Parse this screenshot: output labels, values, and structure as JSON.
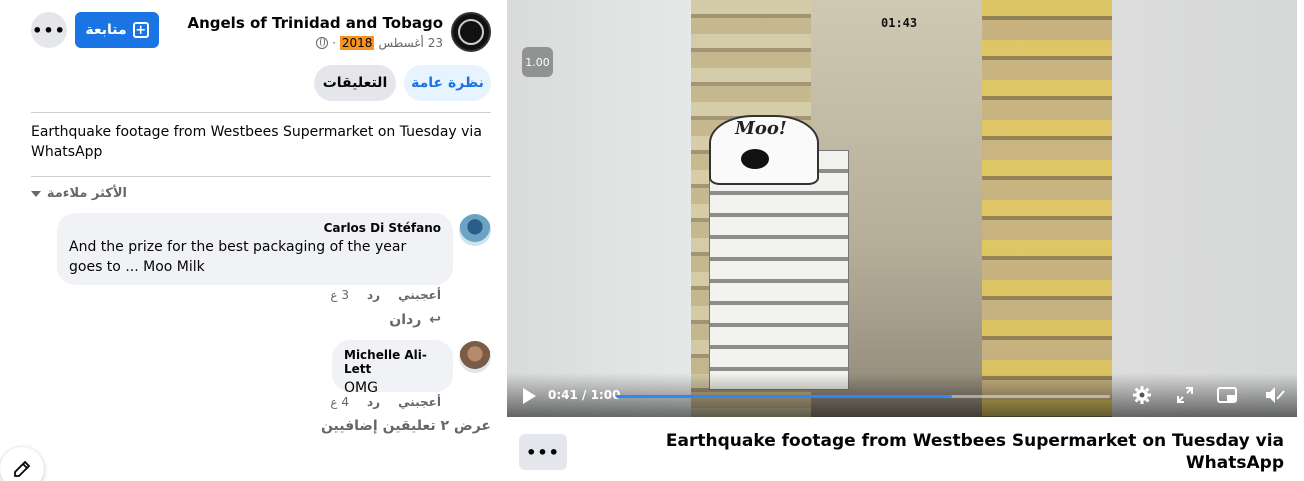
{
  "header": {
    "page_name": "Angels of Trinidad and Tobago",
    "date_prefix": "23 أغسطس",
    "date_year": "2018",
    "follow_label": "متابعة",
    "more_label": "•••"
  },
  "tabs": [
    {
      "label": "نظرة عامة",
      "active": true
    },
    {
      "label": "التعليقات",
      "active": false
    }
  ],
  "caption": "Earthquake footage from Westbees Supermarket on Tuesday via WhatsApp",
  "comments": {
    "sort_label": "الأكثر ملاءمة",
    "items": [
      {
        "author": "Carlos Di Stéfano",
        "text": "And the prize for the best packaging of the year goes to ... Moo Milk",
        "like_label": "أعجبني",
        "reply_label": "رد",
        "time": "3 ع",
        "replies_label": "ردان"
      },
      {
        "author": "Michelle Ali-Lett",
        "text": "OMG",
        "like_label": "أعجبني",
        "reply_label": "رد",
        "time": "4 ع"
      }
    ],
    "more_comments_label": "عرض ٢ تعليقين إضافيين"
  },
  "video": {
    "timestamp_overlay": "01:43",
    "sign_text": "Moo!",
    "speed_badge": "1.00",
    "time_display": "0:41 / 1:00",
    "progress": 0.68,
    "accent_color": "#2d88ff",
    "icons": [
      "play-icon",
      "settings-icon",
      "fullscreen-icon",
      "pip-icon",
      "mute-icon"
    ],
    "more_label": "•••",
    "title": "Earthquake footage from Westbees Supermarket on Tuesday via WhatsApp"
  },
  "colors": {
    "follow_button": "#1b74e4",
    "overview_tab_bg": "#e7f3ff",
    "date_highlight": "#f7931e"
  }
}
